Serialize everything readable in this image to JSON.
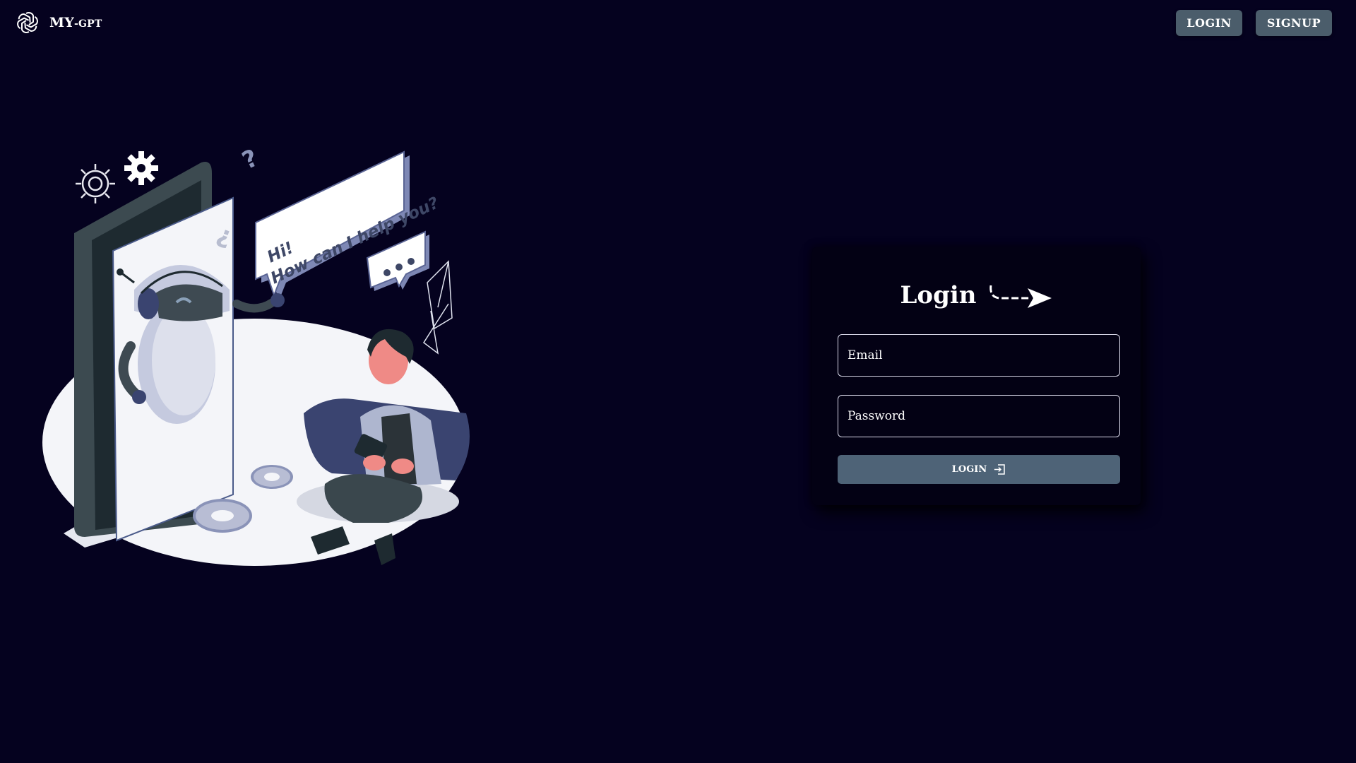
{
  "app": {
    "brand_main": "MY",
    "brand_suffix": "-GPT",
    "logo_icon": "openai-knot-icon"
  },
  "nav": {
    "login_label": "LOGIN",
    "signup_label": "SIGNUP"
  },
  "illustration": {
    "speech_line_1": "Hi!",
    "speech_line_2": "How can I help you?",
    "icon": "chatbot-illustration"
  },
  "login_card": {
    "title": "Login",
    "email_placeholder": "Email",
    "password_placeholder": "Password",
    "submit_label": "LOGIN",
    "submit_icon": "enter-icon",
    "title_icon": "curved-arrow-icon"
  },
  "colors": {
    "background": "#05021f",
    "card": "#030114",
    "nav_button": "#4b5d6b",
    "submit_button": "#4e6377"
  }
}
